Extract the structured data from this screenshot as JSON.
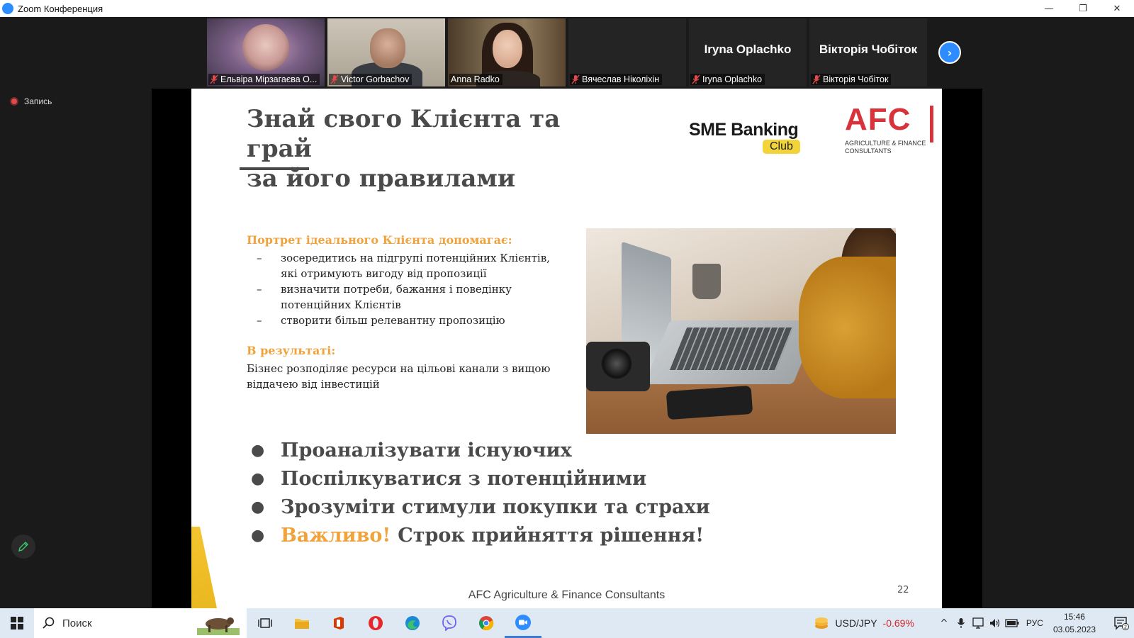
{
  "window": {
    "title": "Zoom Конференция",
    "controls": {
      "minimize": "—",
      "restore": "❐",
      "close": "✕"
    }
  },
  "participants": [
    {
      "name": "Ельвіра Мірзагаєва  О...",
      "has_video": true,
      "muted": true
    },
    {
      "name": "Victor Gorbachov",
      "has_video": true,
      "muted": true
    },
    {
      "name": "Anna Radko",
      "has_video": true,
      "muted": false,
      "active": true
    },
    {
      "name": "Вячеслав Ніколіхін",
      "has_video": false,
      "muted": true
    },
    {
      "name": "Iryna Oplachko",
      "display_name": "Iryna Oplachko",
      "has_video": false,
      "muted": true
    },
    {
      "name": "Вікторія Чобіток",
      "display_name": "Вікторія Чобіток",
      "has_video": false,
      "muted": true
    }
  ],
  "recording": {
    "label": "Запись"
  },
  "slide": {
    "title_line1": "Знай свого Клієнта та грай",
    "title_line2": "за його правилами",
    "sme_logo": {
      "main": "SME Banking",
      "badge": "Club"
    },
    "afc_logo": {
      "main": "AFC",
      "sub_line1": "AGRICULTURE & FINANCE",
      "sub_line2": "CONSULTANTS"
    },
    "portrait_heading": "Портрет ідеального Клієнта допомагає:",
    "portrait_items": [
      {
        "dash": "–",
        "line1": "зосередитись на підгрупі потенційних Клієнтів,",
        "line2": "які отримують вигоду від пропозиції"
      },
      {
        "dash": "–",
        "line1": "визначити потреби, бажання і поведінку",
        "line2": "потенційних Клієнтів"
      },
      {
        "dash": "–",
        "line1": "створити більш релевантну пропозицію",
        "line2": ""
      }
    ],
    "result_heading": "В результаті:",
    "result_text": "Бізнес розподіляє ресурси на цільові канали з вищою віддачею від інвестицій",
    "actions": [
      {
        "bullet": "●",
        "highlight": "",
        "text": "Проаналізувати існуючих"
      },
      {
        "bullet": "●",
        "highlight": "",
        "text": "Поспілкуватися з потенційними"
      },
      {
        "bullet": "●",
        "highlight": "",
        "text": "Зрозуміти стимули покупки та страхи"
      },
      {
        "bullet": "●",
        "highlight": "Важливо!",
        "text": "Строк прийняття рішення!"
      }
    ],
    "footer": "AFC Agriculture & Finance Consultants",
    "page_number": "22"
  },
  "taskbar": {
    "search_label": "Поиск",
    "stock": {
      "pair": "USD/JPY",
      "change": "-0.69%"
    },
    "language": "РУС",
    "time": "15:46",
    "date": "03.05.2023",
    "notification_count": "2"
  },
  "colors": {
    "accent_orange": "#f0a33c",
    "afc_red": "#d8333a",
    "zoom_blue": "#2d8cff",
    "stock_red": "#d7262e"
  }
}
